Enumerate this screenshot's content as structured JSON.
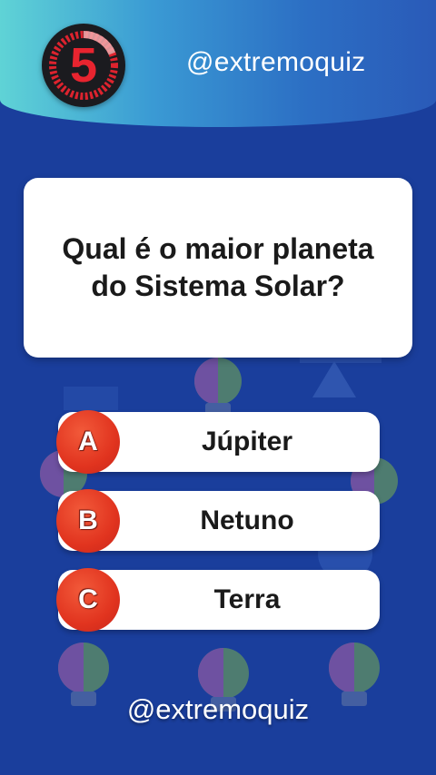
{
  "timer": {
    "value": "5",
    "icon": "countdown-ring-icon"
  },
  "header": {
    "handle": "@extremoquiz"
  },
  "question": {
    "text": "Qual é o maior planeta do Sistema Solar?"
  },
  "options": [
    {
      "letter": "A",
      "label": "Júpiter"
    },
    {
      "letter": "B",
      "label": "Netuno"
    },
    {
      "letter": "C",
      "label": "Terra"
    }
  ],
  "footer": {
    "handle": "@extremoquiz"
  },
  "colors": {
    "background": "#1a3e9c",
    "accent_red": "#e1341f",
    "timer_red": "#e8242f",
    "header_cyan": "#5fd3d6"
  }
}
